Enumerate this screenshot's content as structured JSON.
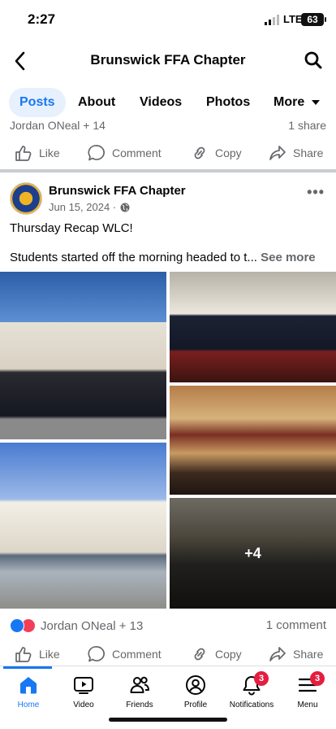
{
  "status_bar": {
    "time": "2:27",
    "network": "LTE",
    "battery": "63"
  },
  "header": {
    "title": "Brunswick FFA Chapter"
  },
  "tabs": [
    {
      "label": "Posts",
      "active": true
    },
    {
      "label": "About"
    },
    {
      "label": "Videos"
    },
    {
      "label": "Photos"
    },
    {
      "label": "More"
    }
  ],
  "prev_post": {
    "reactions_text": "Jordan ONeal + 14",
    "share_text": "1 share",
    "actions": {
      "like": "Like",
      "comment": "Comment",
      "copy": "Copy",
      "share": "Share"
    }
  },
  "post": {
    "author": "Brunswick FFA Chapter",
    "date": "Jun 15, 2024 · ",
    "line1": "Thursday Recap WLC!",
    "line2": "Students started off the morning headed to t...",
    "see_more": "See more",
    "more_photos": "+4",
    "reactions_text": "Jordan ONeal + 13",
    "comments": "1 comment",
    "actions": {
      "like": "Like",
      "comment": "Comment",
      "copy": "Copy",
      "share": "Share"
    }
  },
  "bottom_nav": {
    "items": [
      {
        "label": "Home",
        "active": true
      },
      {
        "label": "Video"
      },
      {
        "label": "Friends"
      },
      {
        "label": "Profile"
      },
      {
        "label": "Notifications",
        "badge": "3"
      },
      {
        "label": "Menu",
        "badge": "3"
      }
    ]
  },
  "colors": {
    "accent": "#1877f2",
    "badge": "#e41e3f",
    "muted": "#65676b"
  }
}
